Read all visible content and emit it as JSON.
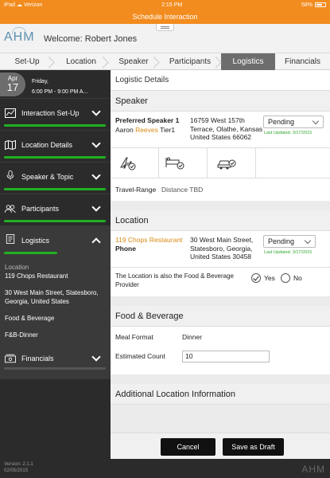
{
  "status_bar": {
    "carrier": "iPad ☁ Verizon",
    "time": "2:15 PM",
    "battery": "58%"
  },
  "title_bar": {
    "title": "Schedule Interaction"
  },
  "header": {
    "logo": "AHM",
    "welcome": "Welcome: Robert Jones"
  },
  "steps": [
    {
      "label": "Set-Up",
      "active": false
    },
    {
      "label": "Location",
      "active": false
    },
    {
      "label": "Speaker",
      "active": false
    },
    {
      "label": "Participants",
      "active": false
    },
    {
      "label": "Logistics",
      "active": true
    },
    {
      "label": "Financials",
      "active": false
    }
  ],
  "sidebar": {
    "date": {
      "month": "Apr",
      "day": "17",
      "weekday": "Friday,",
      "time": "6:00 PM - 9:00 PM A..."
    },
    "items": [
      {
        "label": "Interaction Set-Up",
        "icon": "chart-icon"
      },
      {
        "label": "Location Details",
        "icon": "map-icon"
      },
      {
        "label": "Speaker & Topic",
        "icon": "microphone-icon"
      },
      {
        "label": "Participants",
        "icon": "people-icon"
      },
      {
        "label": "Logistics",
        "icon": "document-icon"
      },
      {
        "label": "Financials",
        "icon": "money-icon"
      }
    ],
    "logistics_details": {
      "location_label": "Location",
      "location_name": "119 Chops Restaurant",
      "address": "30 West Main Street, Statesboro, Georgia, United States",
      "fb_label": "Food & Beverage",
      "fb_value": "F&B-Dinner"
    },
    "version": "Version: 2.1.1",
    "version_date": "02/05/2015"
  },
  "main": {
    "panel_title": "Logistic Details",
    "speaker_section": {
      "title": "Speaker",
      "preferred_label": "Preferred Speaker 1",
      "speaker_first": "Aaron",
      "speaker_last": "Reeves",
      "speaker_tier": "Tier1",
      "addr1": "16759 West 157th",
      "addr2": "Terrace, Olathe, Kansas",
      "addr3": "United States 66062",
      "status": "Pending",
      "updated": "Last Updated: 3/17/2015",
      "travel_label": "Travel-Range",
      "travel_value": "Distance TBD"
    },
    "location_section": {
      "title": "Location",
      "name": "119 Chops Restaurant",
      "phone_label": "Phone",
      "addr1": "30 West Main Street,",
      "addr2": "Statesboro, Georgia,",
      "addr3": "United States 30458",
      "status": "Pending",
      "updated": "Last Updated: 3/17/2015",
      "fb_question_1": "The Location is also the Food & Beverage",
      "fb_question_2": "Provider",
      "yes_label": "Yes",
      "no_label": "No",
      "selected": "Yes"
    },
    "fb_section": {
      "title": "Food & Beverage",
      "meal_label": "Meal Format",
      "meal_value": "Dinner",
      "count_label": "Estimated Count",
      "count_value": "10"
    },
    "additional_section": {
      "title": "Additional Location Information"
    }
  },
  "buttons": {
    "cancel": "Cancel",
    "draft": "Save as Draft"
  },
  "footer": {
    "logo": "AHM"
  },
  "colors": {
    "accent": "#f28c1e",
    "sidebar": "#2b2b2b",
    "progress": "#22b022",
    "speaker_name": "#d98a13"
  }
}
